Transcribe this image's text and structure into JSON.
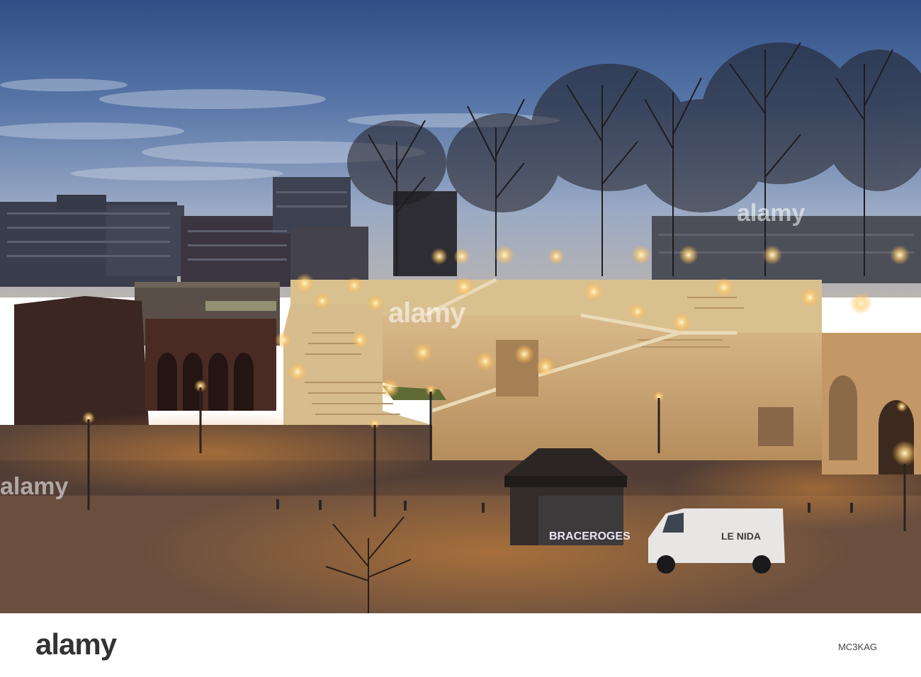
{
  "image": {
    "watermark_text": "alamy",
    "van_lettering": "LE NIDA",
    "graffiti_text": "BRACEROGES"
  },
  "footer": {
    "brand": "alamy",
    "image_id": "MC3KAG"
  }
}
